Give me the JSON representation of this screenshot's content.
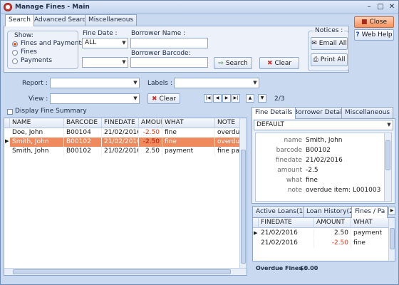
{
  "window": {
    "title": "Manage Fines - Main"
  },
  "top_tabs": [
    "Search",
    "Advanced Search",
    "Miscellaneous"
  ],
  "show_group": {
    "label": "Show:",
    "options": [
      "Fines and Payments",
      "Fines",
      "Payments"
    ],
    "selected": 0
  },
  "fine_date": {
    "label": "Fine Date :",
    "value": "ALL",
    "value2": ""
  },
  "borrower_name": {
    "label": "Borrower Name :",
    "value": ""
  },
  "borrower_barcode": {
    "label": "Borrower Barcode:",
    "value": ""
  },
  "buttons": {
    "search": "Search",
    "clear": "Clear",
    "clear2": "Clear",
    "close": "Close",
    "web_help": "Web Help"
  },
  "notices": {
    "label": "Notices :",
    "email": "Email All",
    "print": "Print All"
  },
  "report": {
    "label": "Report :",
    "value": ""
  },
  "labels": {
    "label": "Labels :",
    "value": ""
  },
  "view": {
    "label": "View :",
    "value": ""
  },
  "pager": {
    "text": "2/3"
  },
  "display_summary": "Display Fine Summary",
  "main_grid": {
    "columns": [
      "NAME",
      "BARCODE",
      "FINEDATE",
      "AMOUNT",
      "WHAT",
      "NOTE"
    ],
    "rows": [
      {
        "name": "Doe, John",
        "barcode": "B00104",
        "finedate": "21/02/2016",
        "amount": "-2.50",
        "what": "fine",
        "note": "overdue"
      },
      {
        "name": "Smith, John",
        "barcode": "B00102",
        "finedate": "21/02/2016",
        "amount": "-2.50",
        "what": "fine",
        "note": "overdue"
      },
      {
        "name": "Smith, John",
        "barcode": "B00102",
        "finedate": "21/02/2016",
        "amount": "2.50",
        "what": "payment",
        "note": "fine pay"
      }
    ],
    "selected_row": 1
  },
  "detail_tabs": [
    "Fine Details",
    "Borrower Details",
    "Miscellaneous"
  ],
  "detail_dropdown": "DEFAULT",
  "details": [
    {
      "key": "name",
      "value": "Smith, John"
    },
    {
      "key": "barcode",
      "value": "B00102"
    },
    {
      "key": "finedate",
      "value": "21/02/2016"
    },
    {
      "key": "amount",
      "value": "-2.5"
    },
    {
      "key": "what",
      "value": "fine"
    },
    {
      "key": "note",
      "value": "overdue item: L001003"
    }
  ],
  "bottom_tabs": [
    "Active Loans(1)",
    "Loan History(2)",
    "Fines / Pa"
  ],
  "fines_grid": {
    "columns": [
      "FINEDATE",
      "AMOUNT",
      "WHAT"
    ],
    "rows": [
      {
        "finedate": "21/02/2016",
        "amount": "2.50",
        "what": "payment"
      },
      {
        "finedate": "21/02/2016",
        "amount": "-2.50",
        "what": "fine"
      }
    ]
  },
  "overdue": {
    "label": "Overdue Fines :",
    "value": "$0.00"
  }
}
